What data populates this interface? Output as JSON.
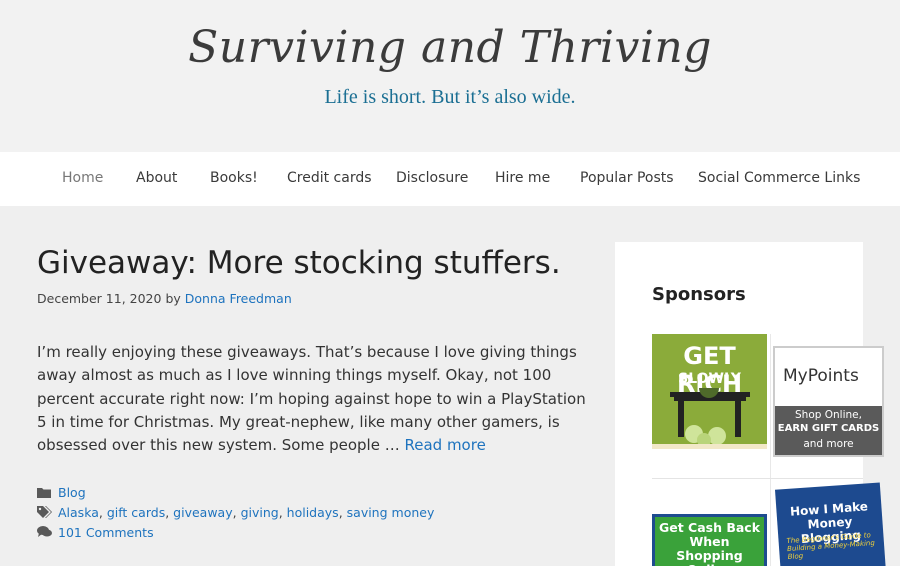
{
  "site": {
    "title": "Surviving and Thriving",
    "tagline": "Life is short. But it’s also wide."
  },
  "nav": {
    "items": [
      {
        "label": "Home",
        "active": true
      },
      {
        "label": "About"
      },
      {
        "label": "Books!"
      },
      {
        "label": "Credit cards"
      },
      {
        "label": "Disclosure"
      },
      {
        "label": "Hire me"
      },
      {
        "label": "Popular Posts"
      },
      {
        "label": "Social Commerce Links"
      }
    ]
  },
  "post": {
    "title": "Giveaway: More stocking stuffers.",
    "date": "December 11, 2020",
    "by": "by",
    "author": "Donna Freedman",
    "excerpt": "I’m really enjoying these giveaways. That’s because I love giving things away almost as much as I love winning things myself. Okay, not 100 percent accurate right now: I’m hoping against hope to win a PlayStation 5 in time for Christmas. My great-nephew, like many other gamers, is obsessed over this new system. Some people …",
    "read_more": "Read more",
    "category": "Blog",
    "tags": [
      {
        "label": "Alaska",
        "sep": ", "
      },
      {
        "label": "gift cards",
        "sep": ", "
      },
      {
        "label": "giveaway",
        "sep": ", "
      },
      {
        "label": "giving",
        "sep": ", "
      },
      {
        "label": "holidays",
        "sep": ", "
      },
      {
        "label": "saving money",
        "sep": ""
      }
    ],
    "comments": "101 Comments"
  },
  "sidebar": {
    "title": "Sponsors",
    "ads": {
      "getrich": {
        "line1": "GET RICH",
        "line2": "SLOWLY"
      },
      "mypoints": {
        "logo": "MyPoints",
        "line1": "Shop Online,",
        "line2": "EARN GIFT CARDS",
        "line3": "and more"
      },
      "cashback": {
        "text": "Get Cash Back When Shopping Online"
      },
      "book": {
        "title": "How I Make Money Blogging",
        "subtitle": "The Beginner's Guide to Building a Money-Making Blog"
      }
    }
  },
  "colors": {
    "link": "#1e73be",
    "tagline": "#1b6f93",
    "header_bg": "#f2f2f2",
    "page_bg": "#efefef"
  }
}
